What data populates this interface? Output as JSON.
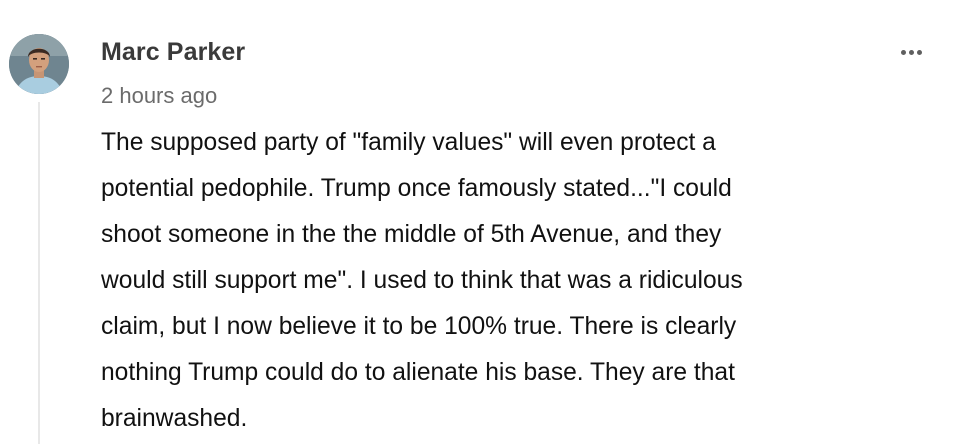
{
  "comment": {
    "author": "Marc Parker",
    "timestamp": "2 hours ago",
    "more_icon": "ellipsis-horizontal-icon",
    "body_lines": [
      "The supposed party of \"family values\" will even protect a",
      "potential pedophile. Trump once famously stated...\"I could",
      "shoot someone in the the middle of 5th Avenue, and they",
      "would still support me\". I used to think that was a ridiculous",
      "claim, but I now believe it to be 100% true. There is clearly",
      "nothing Trump could do to alienate his base. They are that",
      "brainwashed."
    ]
  },
  "colors": {
    "author": "#3a3a3a",
    "timestamp": "#6b6b6b",
    "body_text": "#111111",
    "thread_line": "#e8e8e8",
    "more_icon": "#5f5f5f"
  }
}
